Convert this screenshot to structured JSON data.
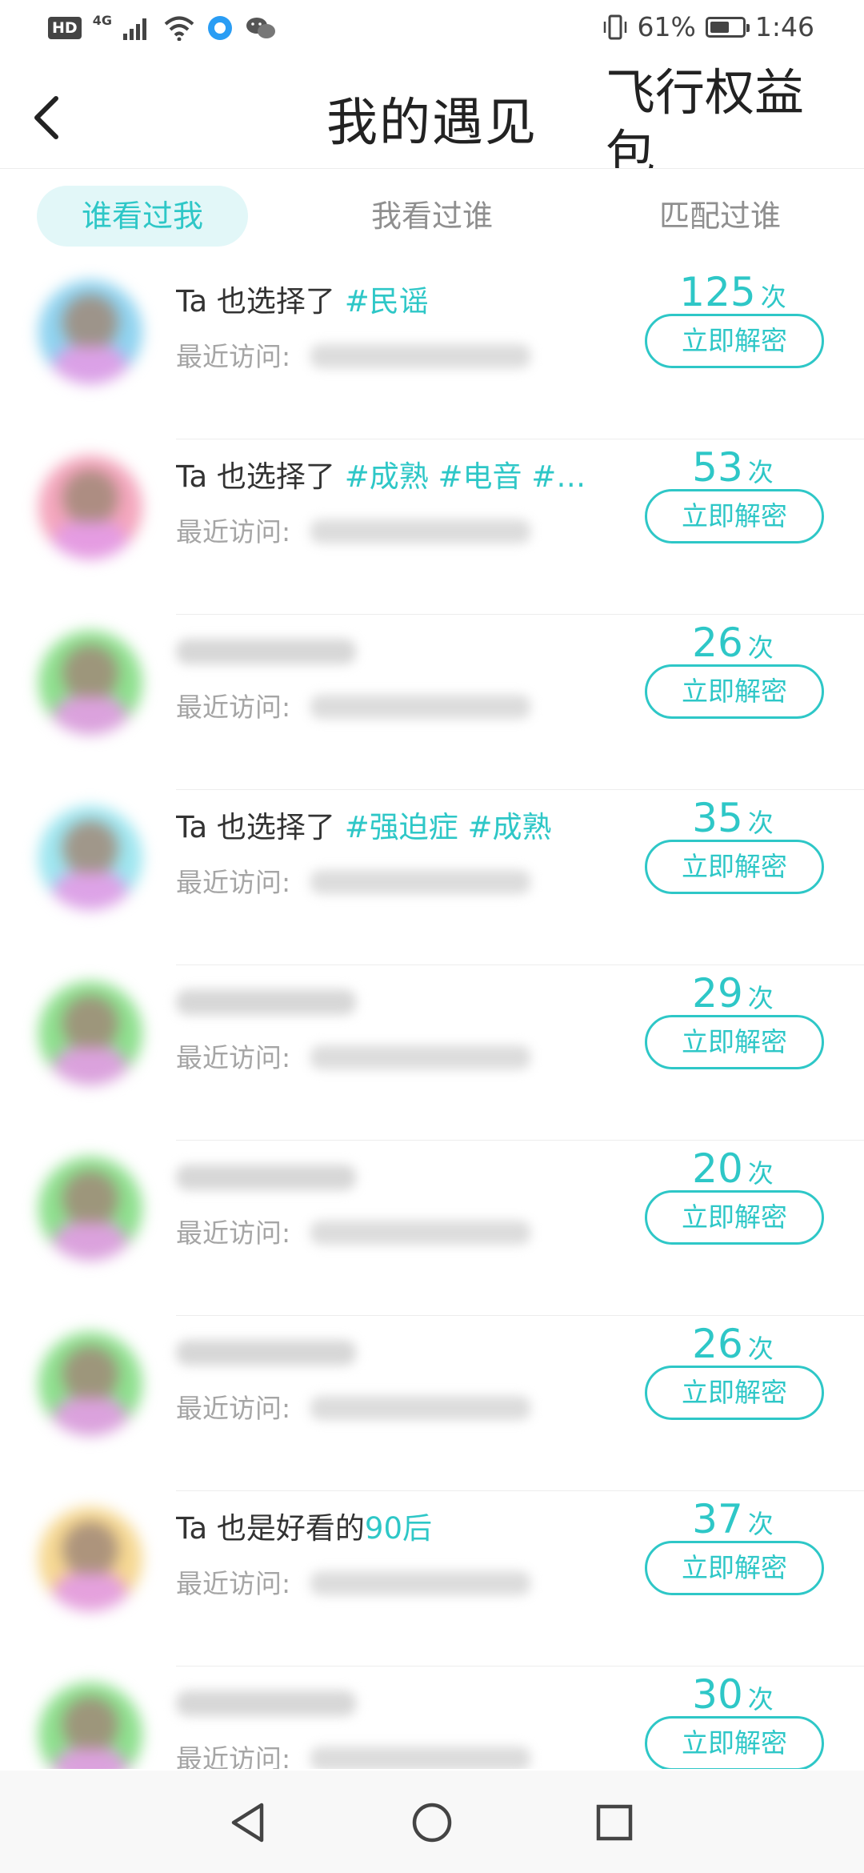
{
  "status_bar": {
    "hd": "HD",
    "network": "4G",
    "battery_text": "61%",
    "battery_level": 0.61,
    "time": "1:46"
  },
  "header": {
    "title": "我的遇见",
    "right_link": "飞行权益包"
  },
  "tabs": [
    {
      "label": "谁看过我",
      "active": true
    },
    {
      "label": "我看过谁",
      "active": false
    },
    {
      "label": "匹配过谁",
      "active": false
    }
  ],
  "visit_label": "最近访问:",
  "unit": "次",
  "button_label": "立即解密",
  "rows": [
    {
      "prefix": "Ta 也选择了 ",
      "highlight": "#民谣",
      "count": "125",
      "avatar_color": "#8fd3f0"
    },
    {
      "prefix": "Ta 也选择了 ",
      "highlight": "#成熟 #电音 #…",
      "count": "53",
      "avatar_color": "#f4a6bd"
    },
    {
      "prefix": "",
      "highlight": "",
      "count": "26",
      "avatar_color": "#8ee08e"
    },
    {
      "prefix": "Ta 也选择了 ",
      "highlight": "#强迫症 #成熟",
      "count": "35",
      "avatar_color": "#9ee6f0"
    },
    {
      "prefix": "",
      "highlight": "",
      "count": "29",
      "avatar_color": "#8ee08e"
    },
    {
      "prefix": "",
      "highlight": "",
      "count": "20",
      "avatar_color": "#8ee08e"
    },
    {
      "prefix": "",
      "highlight": "",
      "count": "26",
      "avatar_color": "#8ee08e"
    },
    {
      "prefix": "Ta 也是好看的",
      "highlight": "90后",
      "count": "37",
      "avatar_color": "#f6d892"
    },
    {
      "prefix": "",
      "highlight": "",
      "count": "30",
      "avatar_color": "#8ee08e"
    }
  ],
  "colors": {
    "accent": "#2ec7c7",
    "tab_active_bg": "#e2f7f8"
  },
  "nav": {
    "back": "back-triangle-icon",
    "home": "home-circle-icon",
    "recents": "recents-square-icon"
  }
}
